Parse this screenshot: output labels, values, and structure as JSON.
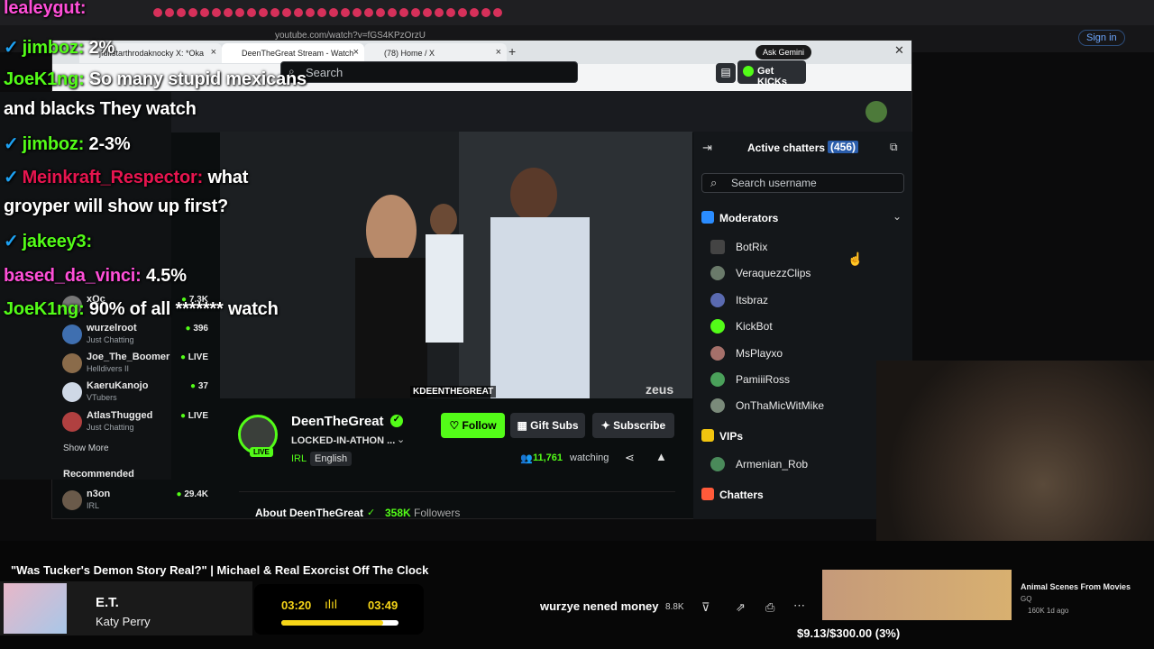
{
  "outer_url": "youtube.com/watch?v=fGS4KPzOrzU",
  "outer_signin": "Sign in",
  "tabs": [
    {
      "label": "jfulfstarthrodaknocky X: *Oka"
    },
    {
      "label": "DeenTheGreat Stream - Watch"
    },
    {
      "label": "(78) Home / X"
    }
  ],
  "ask_gemini": "Ask Gemini",
  "header": {
    "search_placeholder": "Search",
    "get_kicks": "Get KICKs"
  },
  "sidebar": {
    "channels": [
      {
        "name": "xQc",
        "category": "Just Chatting",
        "stat": "7.3K"
      },
      {
        "name": "wurzelroot",
        "category": "Just Chatting",
        "stat": "396"
      },
      {
        "name": "Joe_The_Boomer",
        "category": "Helldivers II",
        "stat": "LIVE"
      },
      {
        "name": "KaeruKanojo",
        "category": "VTubers",
        "stat": "37"
      },
      {
        "name": "AtlasThugged",
        "category": "Just Chatting",
        "stat": "LIVE"
      }
    ],
    "show_more": "Show More",
    "recommended_label": "Recommended",
    "recommended": [
      {
        "name": "n3on",
        "category": "IRL",
        "stat": "29.4K"
      }
    ]
  },
  "video": {
    "watermark": "KDEENTHEGREAT",
    "brand": "zeus"
  },
  "stream": {
    "name": "DeenTheGreat",
    "title": "LOCKED-IN-ATHON ...",
    "category": "IRL",
    "language": "English",
    "live": "LIVE",
    "follow": "Follow",
    "gift_subs": "Gift Subs",
    "subscribe": "Subscribe",
    "watching_count": "11,761",
    "watching_label": "watching",
    "about_label": "About DeenTheGreat",
    "followers_count": "358K",
    "followers_label": "Followers"
  },
  "chatters_panel": {
    "title": "Active chatters",
    "count": "(456)",
    "search_placeholder": "Search username",
    "moderators_label": "Moderators",
    "moderators": [
      "BotRix",
      "VeraquezzClips",
      "Itsbraz",
      "KickBot",
      "MsPlayxo",
      "PamiiiRoss",
      "OnThaMicWitMike"
    ],
    "vips_label": "VIPs",
    "vips": [
      "Armenian_Rob"
    ],
    "chatters_label": "Chatters"
  },
  "chat_overlay": [
    {
      "user": "lealeygut:",
      "text": "",
      "color": "pink"
    },
    {
      "user": "jimboz:",
      "text": "2%",
      "color": "green"
    },
    {
      "user": "JoeK1ng:",
      "text": "So many stupid mexicans",
      "color": "green"
    },
    {
      "user": "",
      "text": "and blacks They watch",
      "color": "white"
    },
    {
      "user": "jimboz:",
      "text": "2-3%",
      "color": "green"
    },
    {
      "user": "Meinkraft_Respector:",
      "text": "what",
      "color": "red"
    },
    {
      "user": "",
      "text": "groyper will show up first?",
      "color": "white"
    },
    {
      "user": "jakeey3:",
      "text": "",
      "color": "green"
    },
    {
      "user": "based_da_vinci:",
      "text": "4.5%",
      "color": "pink"
    },
    {
      "user": "JoeK1ng:",
      "text": "90% of all ******* watch",
      "color": "green"
    }
  ],
  "bottom": {
    "video_title": "\"Was Tucker's Demon Story Real?\" | Michael & Real Exorcist Off The Clock",
    "song": "E.T.",
    "artist": "Katy Perry",
    "time_elapsed": "03:20",
    "time_total": "03:49",
    "progress": 0.87,
    "donation_text": "wurzye nened money",
    "likes": "8.8K",
    "goal_text": "$9.13/$300.00 (3%)",
    "rec_title": "Animal Scenes From Movies",
    "rec_channel": "GQ",
    "rec_meta": "160K  1d ago"
  },
  "colors": {
    "kick_green": "#53fc18",
    "bg": "#0b0e0f",
    "panel": "#14171a"
  }
}
